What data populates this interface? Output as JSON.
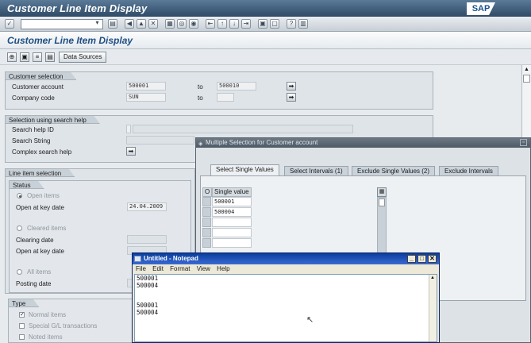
{
  "window": {
    "title": "Customer Line Item Display",
    "brand": "SAP"
  },
  "screen": {
    "title": "Customer Line Item Display"
  },
  "app_toolbar": {
    "data_sources_label": "Data Sources"
  },
  "customer_selection": {
    "title": "Customer selection",
    "customer_account_label": "Customer account",
    "customer_account_from": "500001",
    "to_label": "to",
    "customer_account_to": "500010",
    "company_code_label": "Company code",
    "company_code_from": "SUN"
  },
  "search_help": {
    "title": "Selection using search help",
    "search_help_id_label": "Search help ID",
    "search_string_label": "Search String",
    "complex_search_label": "Complex search help"
  },
  "line_item_selection": {
    "title": "Line item selection",
    "status_title": "Status",
    "open_items_label": "Open items",
    "open_at_key_date_label": "Open at key date",
    "open_at_key_date_value": "24.04.2009",
    "cleared_items_label": "Cleared items",
    "clearing_date_label": "Clearing date",
    "open_at_key_date2_label": "Open at key date",
    "all_items_label": "All items",
    "posting_date_label": "Posting date"
  },
  "type": {
    "title": "Type",
    "normal_items_label": "Normal items",
    "special_gl_label": "Special G/L transactions",
    "noted_items_label": "Noted items"
  },
  "multi_select": {
    "title": "Multiple Selection for Customer account",
    "tabs": [
      "Select Single Values",
      "Select Intervals (1)",
      "Exclude Single Values (2)",
      "Exclude Intervals"
    ],
    "col_o": "O",
    "col_single_value": "Single value",
    "values": [
      "500001",
      "500004"
    ]
  },
  "notepad": {
    "title": "Untitled - Notepad",
    "menu": [
      "File",
      "Edit",
      "Format",
      "View",
      "Help"
    ],
    "content": "500001\n500004\n\n\n500001\n500004"
  }
}
